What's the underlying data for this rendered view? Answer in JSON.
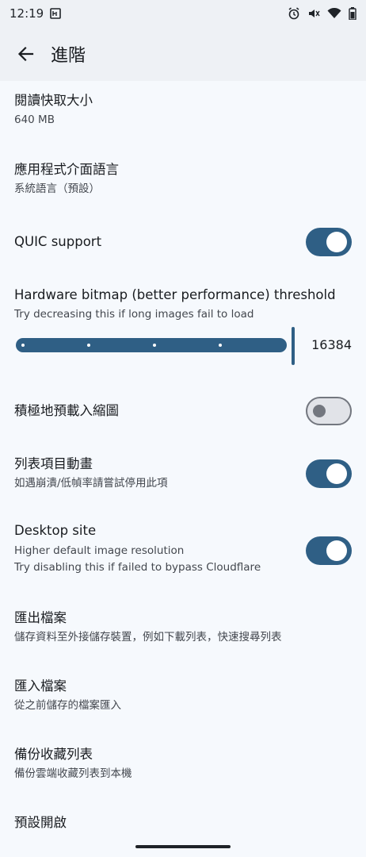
{
  "status_bar": {
    "time": "12:19",
    "icons": [
      "notification-icon",
      "alarm-icon",
      "mute-icon",
      "wifi-icon",
      "battery-icon"
    ]
  },
  "app_bar": {
    "title": "進階"
  },
  "settings": {
    "read_cache": {
      "title": "閱讀快取大小",
      "value": "640 MB"
    },
    "language": {
      "title": "應用程式介面語言",
      "value": "系統語言（預設）"
    },
    "quic": {
      "title": "QUIC support",
      "enabled": true
    },
    "hw_bitmap": {
      "title": "Hardware bitmap (better performance) threshold",
      "subtitle": "Try decreasing this if long images fail to load",
      "value": "16384",
      "fraction": 1.0
    },
    "preload_thumbs": {
      "title": "積極地預載入縮圖",
      "enabled": false
    },
    "list_anim": {
      "title": "列表項目動畫",
      "subtitle": "如遇崩潰/低幀率請嘗試停用此項",
      "enabled": true
    },
    "desktop_site": {
      "title": "Desktop site",
      "subtitle1": "Higher default image resolution",
      "subtitle2": "Try disabling this if failed to bypass Cloudflare",
      "enabled": true
    },
    "export": {
      "title": "匯出檔案",
      "subtitle": "儲存資料至外接儲存裝置，例如下載列表，快速搜尋列表"
    },
    "import": {
      "title": "匯入檔案",
      "subtitle": "從之前儲存的檔案匯入"
    },
    "backup_fav": {
      "title": "備份收藏列表",
      "subtitle": "備份雲端收藏列表到本機"
    },
    "default_open": {
      "title": "預設開啟"
    }
  },
  "colors": {
    "accent": "#2f5f85",
    "background": "#f6f9fd",
    "appbar": "#eef1f5"
  }
}
